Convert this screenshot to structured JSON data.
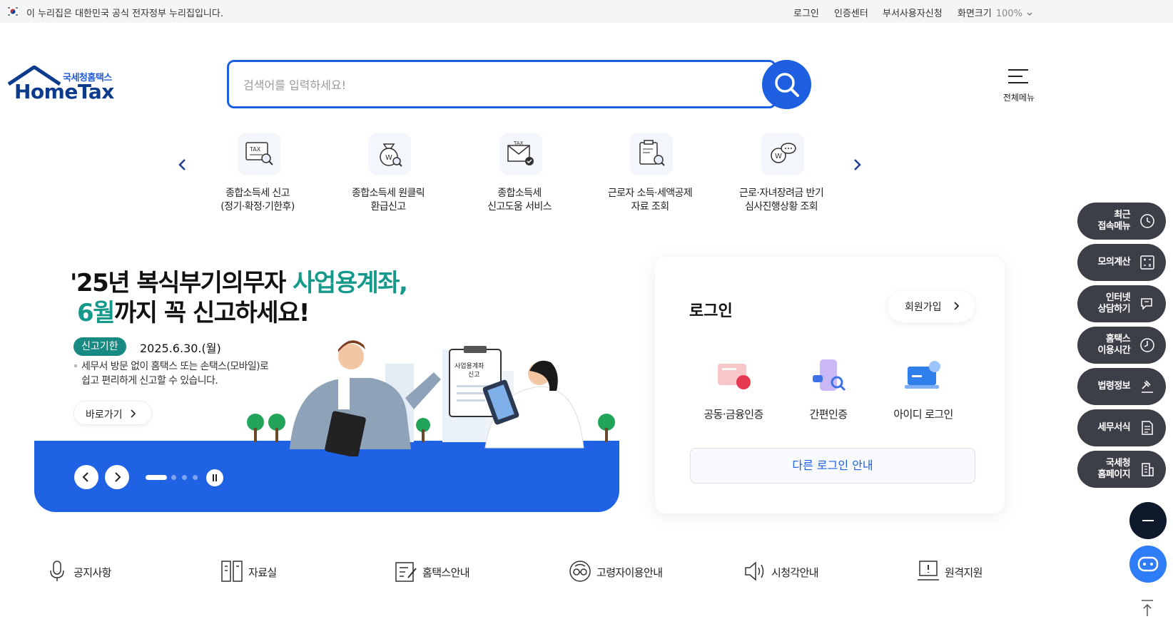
{
  "topbar": {
    "gov_notice": "이 누리집은 대한민국 공식 전자정부 누리집입니다.",
    "links": [
      "로그인",
      "인증센터",
      "부서사용자신청"
    ],
    "zoom_label": "화면크기",
    "zoom_value": "100%"
  },
  "header": {
    "logo_sub": "국세청홈택스",
    "logo_main": "HomeTax",
    "search_placeholder": "검색어를 입력하세요!",
    "menu_label": "전체메뉴"
  },
  "quick_services": [
    {
      "label": "종합소득세 신고\n(정기·확정·기한후)",
      "icon": "tax-report-icon"
    },
    {
      "label": "종합소득세 원클릭\n환급신고",
      "icon": "money-bag-icon"
    },
    {
      "label": "종합소득세\n신고도움 서비스",
      "icon": "tax-envelope-icon"
    },
    {
      "label": "근로자 소득·세액공제\n자료 조회",
      "icon": "document-search-icon"
    },
    {
      "label": "근로·자녀장려금 반기\n심사진행상황 조회",
      "icon": "chat-bubble-icon"
    }
  ],
  "banner": {
    "title_line1_a": "'25년 복식부기의무자 ",
    "title_line1_b": "사업용계좌,",
    "title_line2_a": "6월",
    "title_line2_b": "까지 꼭 신고하세요!",
    "badge": "신고기한",
    "date": "2025.6.30.(월)",
    "desc": "세무서 방문 없이 홈택스 또는 손택스(모바일)로\n쉽고 편리하게 신고할 수 있습니다.",
    "goto_label": "바로가기",
    "clipboard_text": "사업용계좌\n신고",
    "slide_count": 4,
    "active_slide": 1
  },
  "login": {
    "title": "로그인",
    "join_label": "회원가입",
    "options": [
      "공동·금융인증",
      "간편인증",
      "아이디 로그인"
    ],
    "other_label": "다른 로그인 안내"
  },
  "floating_menu": [
    {
      "label": "최근\n접속메뉴",
      "icon": "clock-icon"
    },
    {
      "label": "모의계산",
      "icon": "calculator-icon"
    },
    {
      "label": "인터넷\n상담하기",
      "icon": "chat-icon"
    },
    {
      "label": "홈택스\n이용시간",
      "icon": "time-icon"
    },
    {
      "label": "법령정보",
      "icon": "gavel-icon"
    },
    {
      "label": "세무서식",
      "icon": "form-icon"
    },
    {
      "label": "국세청\n홈페이지",
      "icon": "building-icon"
    }
  ],
  "bottom_links": [
    {
      "label": "공지사항",
      "icon": "microphone-icon"
    },
    {
      "label": "자료실",
      "icon": "archive-icon"
    },
    {
      "label": "홈택스안내",
      "icon": "guide-icon"
    },
    {
      "label": "고령자이용안내",
      "icon": "senior-icon"
    },
    {
      "label": "시청각안내",
      "icon": "speaker-icon"
    },
    {
      "label": "원격지원",
      "icon": "remote-support-icon"
    }
  ],
  "colors": {
    "primary": "#1d5fe0",
    "teal": "#14998a",
    "dark_float": "#3c3f47",
    "navy": "#0d3b8c"
  }
}
